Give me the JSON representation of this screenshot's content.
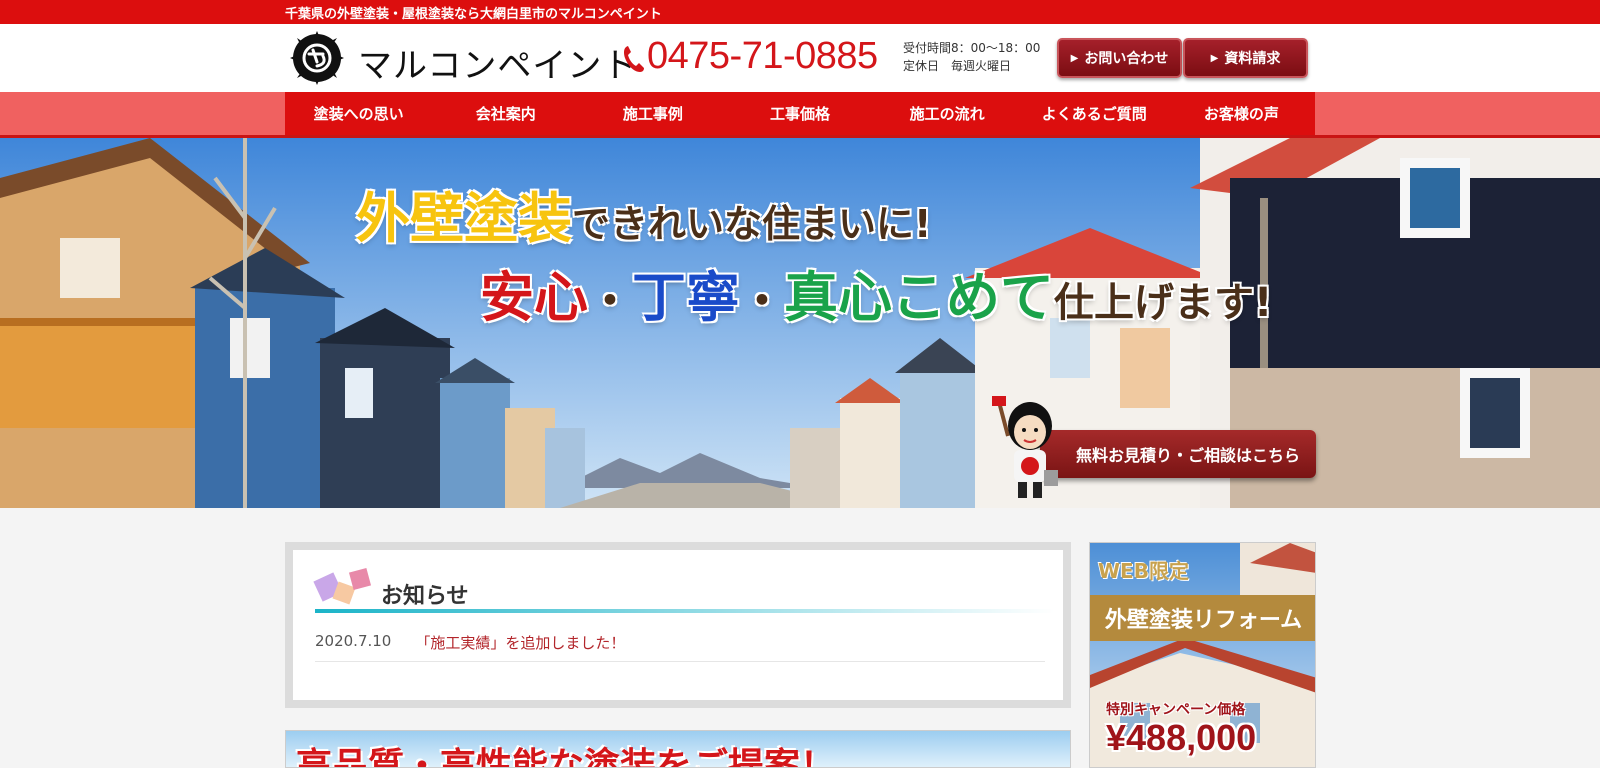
{
  "topbar": {
    "tagline": "千葉県の外壁塗装・屋根塗装なら大網白里市のマルコンペイント"
  },
  "header": {
    "logo_text": "マルコンペイント",
    "phone": "0475-71-0885",
    "hours_line1": "受付時間8：00〜18：00",
    "hours_line2": "定休日　毎週火曜日",
    "contact_button": "お問い合わせ",
    "brochure_button": "資料請求"
  },
  "nav": {
    "items": [
      {
        "label": "塗装への思い"
      },
      {
        "label": "会社案内"
      },
      {
        "label": "施工事例"
      },
      {
        "label": "工事価格"
      },
      {
        "label": "施工の流れ"
      },
      {
        "label": "よくあるご質問"
      },
      {
        "label": "お客様の声"
      }
    ]
  },
  "hero": {
    "line1_emphasis": "外壁塗装",
    "line1_rest": "できれいな住まいに!",
    "line2_word1": "安心",
    "line2_sep": "・",
    "line2_word2": "丁寧",
    "line2_word3": "真心こめて",
    "line2_rest": "仕上げます!",
    "cta": "無料お見積り・ご相談はこちら"
  },
  "news": {
    "title": "お知らせ",
    "items": [
      {
        "date": "2020.7.10",
        "text": "「施工実績」を追加しました！"
      }
    ]
  },
  "bottom_banner": {
    "text": "高品質・高性能な塗装をご提案！"
  },
  "side_banner": {
    "badge": "WEB限定",
    "title": "外壁塗装リフォーム",
    "campaign": "特別キャンペーン価格",
    "price": "¥488,000"
  },
  "colors": {
    "brand_red": "#dc0e0e",
    "nav_band": "#f06160",
    "button_dark_red": "#8b1a1f",
    "accent_teal": "#1bb4c8",
    "hero_yellow": "#f7c40f",
    "hero_blue": "#1a4bc9",
    "hero_green": "#1aa34a"
  },
  "icons": {
    "logo": "brush-circle-logo-icon",
    "phone": "phone-icon",
    "button_arrow": "triangle-right-icon",
    "news": "paper-squares-icon",
    "mascot": "painter-mascot-icon"
  }
}
